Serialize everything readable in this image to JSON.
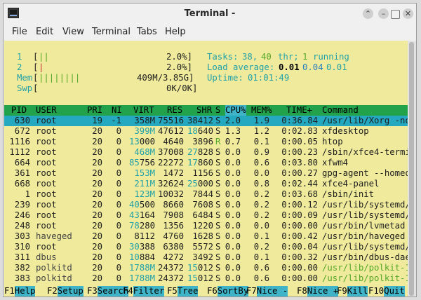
{
  "window": {
    "title": "Terminal -"
  },
  "menu": [
    "File",
    "Edit",
    "View",
    "Terminal",
    "Tabs",
    "Help"
  ],
  "meters": {
    "cpu1": {
      "label": "1",
      "bar": "||",
      "value": "2.0%]"
    },
    "cpu2": {
      "label": "2",
      "bar": "|",
      "value": "2.0%]"
    },
    "mem": {
      "label": "Mem",
      "bar": "||||||||",
      "value": "409M/3.85G]"
    },
    "swp": {
      "label": "Swp",
      "bar": "",
      "value": "0K/0K]"
    }
  },
  "summary": {
    "tasks_label": "Tasks:",
    "tasks": "38,",
    "thr": "40",
    "thr_label": "thr;",
    "running": "1",
    "running_label": "running",
    "load_label": "Load average:",
    "load1": "0.01",
    "load5": "0.04",
    "load15": "0.01",
    "uptime_label": "Uptime:",
    "uptime": "01:01:49"
  },
  "columns": {
    "pid": "PID",
    "user": "USER",
    "pri": "PRI",
    "ni": "NI",
    "virt": "VIRT",
    "res": "RES",
    "shr": "SHR",
    "s": "S",
    "cpu": "CPU%",
    "mem": "MEM%",
    "time": "TIME+",
    "cmd": "Command"
  },
  "processes": [
    {
      "pid": "630",
      "user": "root",
      "pri": "19",
      "ni": "-1",
      "virt": "358M",
      "res": "75516",
      "shr": "38412",
      "s": "S",
      "cpu": "2.0",
      "mem": "1.9",
      "time": "0:36.84",
      "cmd": "/usr/lib/Xorg -no"
    },
    {
      "pid": "672",
      "user": "root",
      "pri": "20",
      "ni": "0",
      "virt": "399M",
      "res": "47612",
      "shr": "18640",
      "s": "S",
      "cpu": "1.3",
      "mem": "1.2",
      "time": "0:02.83",
      "cmd": "xfdesktop"
    },
    {
      "pid": "1116",
      "user": "root",
      "pri": "20",
      "ni": "0",
      "virt": "13000",
      "res": "4640",
      "shr": "3896",
      "s": "R",
      "cpu": "0.7",
      "mem": "0.1",
      "time": "0:00.05",
      "cmd": "htop"
    },
    {
      "pid": "1112",
      "user": "root",
      "pri": "20",
      "ni": "0",
      "virt": "468M",
      "res": "37008",
      "shr": "27828",
      "s": "S",
      "cpu": "0.0",
      "mem": "0.9",
      "time": "0:00.23",
      "cmd": "/sbin/xfce4-termi"
    },
    {
      "pid": "664",
      "user": "root",
      "pri": "20",
      "ni": "0",
      "virt": "85756",
      "res": "22272",
      "shr": "17860",
      "s": "S",
      "cpu": "0.0",
      "mem": "0.6",
      "time": "0:03.80",
      "cmd": "xfwm4"
    },
    {
      "pid": "361",
      "user": "root",
      "pri": "20",
      "ni": "0",
      "virt": "153M",
      "res": "1472",
      "shr": "1156",
      "s": "S",
      "cpu": "0.0",
      "mem": "0.0",
      "time": "0:00.27",
      "cmd": "gpg-agent --homed"
    },
    {
      "pid": "668",
      "user": "root",
      "pri": "20",
      "ni": "0",
      "virt": "211M",
      "res": "32624",
      "shr": "25000",
      "s": "S",
      "cpu": "0.0",
      "mem": "0.8",
      "time": "0:02.44",
      "cmd": "xfce4-panel"
    },
    {
      "pid": "1",
      "user": "root",
      "pri": "20",
      "ni": "0",
      "virt": "123M",
      "res": "10032",
      "shr": "7844",
      "s": "S",
      "cpu": "0.0",
      "mem": "0.2",
      "time": "0:03.68",
      "cmd": "/sbin/init"
    },
    {
      "pid": "239",
      "user": "root",
      "pri": "20",
      "ni": "0",
      "virt": "40500",
      "res": "8660",
      "shr": "7608",
      "s": "S",
      "cpu": "0.0",
      "mem": "0.2",
      "time": "0:00.12",
      "cmd": "/usr/lib/systemd/"
    },
    {
      "pid": "246",
      "user": "root",
      "pri": "20",
      "ni": "0",
      "virt": "43164",
      "res": "7908",
      "shr": "6484",
      "s": "S",
      "cpu": "0.0",
      "mem": "0.2",
      "time": "0:00.09",
      "cmd": "/usr/lib/systemd/"
    },
    {
      "pid": "248",
      "user": "root",
      "pri": "20",
      "ni": "0",
      "virt": "78280",
      "res": "1356",
      "shr": "1220",
      "s": "S",
      "cpu": "0.0",
      "mem": "0.0",
      "time": "0:00.00",
      "cmd": "/usr/bin/lvmetad"
    },
    {
      "pid": "303",
      "user": "haveged",
      "pri": "20",
      "ni": "0",
      "virt": "8112",
      "res": "4760",
      "shr": "1628",
      "s": "S",
      "cpu": "0.0",
      "mem": "0.1",
      "time": "0:00.42",
      "cmd": "/usr/bin/haveged"
    },
    {
      "pid": "310",
      "user": "root",
      "pri": "20",
      "ni": "0",
      "virt": "30388",
      "res": "6380",
      "shr": "5572",
      "s": "S",
      "cpu": "0.0",
      "mem": "0.2",
      "time": "0:00.04",
      "cmd": "/usr/lib/systemd/"
    },
    {
      "pid": "311",
      "user": "dbus",
      "pri": "20",
      "ni": "0",
      "virt": "10884",
      "res": "4272",
      "shr": "3492",
      "s": "S",
      "cpu": "0.0",
      "mem": "0.1",
      "time": "0:00.32",
      "cmd": "/usr/bin/dbus-dae"
    },
    {
      "pid": "382",
      "user": "polkitd",
      "pri": "20",
      "ni": "0",
      "virt": "1788M",
      "res": "24372",
      "shr": "15012",
      "s": "S",
      "cpu": "0.0",
      "mem": "0.6",
      "time": "0:00.00",
      "cmd": "/usr/lib/polkit-1",
      "thread": true
    },
    {
      "pid": "383",
      "user": "polkitd",
      "pri": "20",
      "ni": "0",
      "virt": "1788M",
      "res": "24372",
      "shr": "15012",
      "s": "S",
      "cpu": "0.0",
      "mem": "0.6",
      "time": "0:00.00",
      "cmd": "/usr/lib/polkit-1",
      "thread": true
    }
  ],
  "fkeys": [
    {
      "key": "F1",
      "label": "Help"
    },
    {
      "key": "F2",
      "label": "Setup"
    },
    {
      "key": "F3",
      "label": "Search"
    },
    {
      "key": "F4",
      "label": "Filter"
    },
    {
      "key": "F5",
      "label": "Tree"
    },
    {
      "key": "F6",
      "label": "SortBy"
    },
    {
      "key": "F7",
      "label": "Nice -"
    },
    {
      "key": "F8",
      "label": "Nice +"
    },
    {
      "key": "F9",
      "label": "Kill"
    },
    {
      "key": "F10",
      "label": "Quit"
    }
  ],
  "colors": {
    "terminal_bg": "#f0eb9c",
    "header_bg": "#22a24a",
    "selected_bg": "#24a9c1",
    "cyan": "#22a0a8",
    "green": "#55a82a",
    "red": "#c03030"
  }
}
